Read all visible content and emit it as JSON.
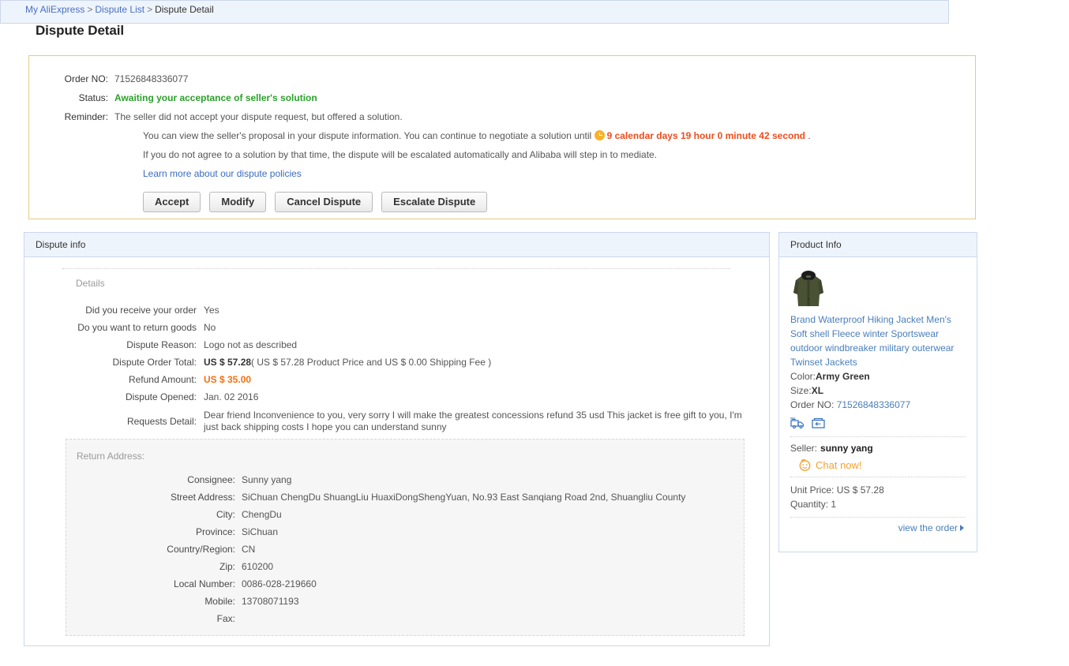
{
  "breadcrumb": {
    "items": [
      {
        "label": "My AliExpress",
        "link": true
      },
      {
        "label": "Dispute List",
        "link": true
      },
      {
        "label": "Dispute Detail",
        "link": false
      }
    ],
    "separator": ">"
  },
  "page_title": "Dispute Detail",
  "top_panel": {
    "order_no_label": "Order NO:",
    "order_no_value": "71526848336077",
    "status_label": "Status:",
    "status_value": "Awaiting your acceptance of seller's solution",
    "reminder_label": "Reminder:",
    "reminder_line1": "The seller did not accept your dispute request, but offered a solution.",
    "reminder_line2_pre": "You can view the seller's proposal in your dispute information. You can continue to negotiate a solution until",
    "countdown": "9 calendar days 19 hour 0 minute 42 second",
    "reminder_line2_post": ".",
    "reminder_line3": "If you do not agree to a solution by that time, the dispute will be escalated automatically and Alibaba will step in to mediate.",
    "policy_link": "Learn more about our dispute policies",
    "clock_icon": "clock-icon",
    "buttons": [
      {
        "label": "Accept",
        "name": "accept-button"
      },
      {
        "label": "Modify",
        "name": "modify-button"
      },
      {
        "label": "Cancel Dispute",
        "name": "cancel-dispute-button"
      },
      {
        "label": "Escalate Dispute",
        "name": "escalate-dispute-button"
      }
    ]
  },
  "dispute_info": {
    "header": "Dispute info",
    "details_label": "Details",
    "rows": [
      {
        "label": "Did you receive your order",
        "value": "Yes"
      },
      {
        "label": "Do you want to return goods",
        "value": "No"
      },
      {
        "label": "Dispute Reason:",
        "value": "Logo not as described"
      },
      {
        "label": "Dispute Order Total:",
        "value_bold": "US $ 57.28",
        "value_rest": "( US $ 57.28 Product Price and US $ 0.00 Shipping Fee )"
      },
      {
        "label": "Refund Amount:",
        "value_orange": "US $ 35.00"
      },
      {
        "label": "Dispute Opened:",
        "value": "Jan. 02 2016"
      },
      {
        "label": "Requests Detail:",
        "value_wrap": "Dear friend Inconvenience to you, very sorry I will make the greatest concessions refund 35 usd This jacket is free gift to you, I'm just back shipping costs I hope you can understand sunny"
      }
    ],
    "return_address": {
      "title": "Return Address:",
      "rows": [
        {
          "label": "Consignee:",
          "value": "Sunny yang"
        },
        {
          "label": "Street Address:",
          "value": "SiChuan ChengDu ShuangLiu HuaxiDongShengYuan, No.93 East Sanqiang Road 2nd, Shuangliu County"
        },
        {
          "label": "City:",
          "value": "ChengDu"
        },
        {
          "label": "Province:",
          "value": "SiChuan"
        },
        {
          "label": "Country/Region:",
          "value": "CN"
        },
        {
          "label": "Zip:",
          "value": "610200"
        },
        {
          "label": "Local Number:",
          "value": "0086-028-219660"
        },
        {
          "label": "Mobile:",
          "value": "13708071193"
        },
        {
          "label": "Fax:",
          "value": ""
        }
      ]
    }
  },
  "product_info": {
    "header": "Product Info",
    "thumb_alt": "product-thumbnail-army-green-jacket",
    "title": "Brand Waterproof Hiking Jacket Men's Soft shell Fleece winter Sportswear outdoor windbreaker military outerwear Twinset Jackets",
    "color_label": "Color:",
    "color_value": "Army Green",
    "size_label": "Size:",
    "size_value": "XL",
    "order_no_label": "Order NO:",
    "order_no_value": "71526848336077",
    "icons": [
      "shipping-truck-icon",
      "return-box-icon"
    ],
    "seller_label": "Seller:",
    "seller_value": "sunny yang",
    "chat_label": "Chat now!",
    "chat_icon": "chat-face-icon",
    "unit_price_label": "Unit Price:",
    "unit_price_value": "US $ 57.28",
    "quantity_label": "Quantity:",
    "quantity_value": "1",
    "view_order_label": "view the order"
  },
  "colors": {
    "accent_blue": "#4a7ebb",
    "link_blue": "#3a6bc4",
    "status_green": "#2aa12a",
    "warning_orange": "#f04d1e",
    "refund_orange": "#f5700f",
    "chat_orange": "#f7a131",
    "panel_header_bg": "#eef4fb",
    "panel_border": "#cbd9ec",
    "top_panel_border": "#e3ca85"
  }
}
